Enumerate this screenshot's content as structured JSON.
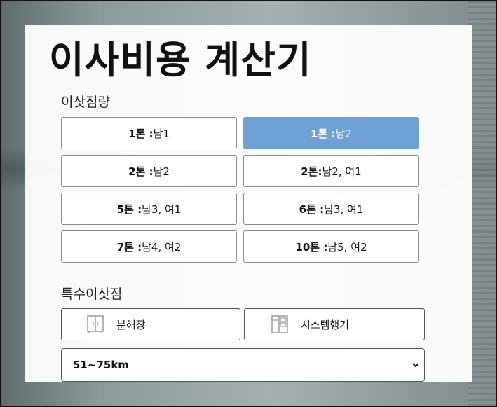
{
  "title": "이사비용 계산기",
  "volume": {
    "label": "이삿짐량",
    "options": [
      {
        "bold": "1톤 :",
        "rest": " 남1",
        "selected": false
      },
      {
        "bold": "1톤 :",
        "rest": " 남2",
        "selected": true
      },
      {
        "bold": "2톤 :",
        "rest": " 남2",
        "selected": false
      },
      {
        "bold": "2톤:",
        "rest": " 남2, 여1",
        "selected": false
      },
      {
        "bold": "5톤 :",
        "rest": " 남3, 여1",
        "selected": false
      },
      {
        "bold": "6톤 :",
        "rest": " 남3, 여1",
        "selected": false
      },
      {
        "bold": "7톤 :",
        "rest": " 남4, 여2",
        "selected": false
      },
      {
        "bold": "10톤 :",
        "rest": " 남5, 여2",
        "selected": false
      }
    ]
  },
  "special": {
    "label": "특수이삿짐",
    "items": [
      {
        "label": "분해장",
        "icon": "wardrobe-icon"
      },
      {
        "label": "시스템행거",
        "icon": "system-hanger-icon"
      }
    ]
  },
  "distance": {
    "selected": "51~75km"
  },
  "colors": {
    "accent": "#6fa0d4",
    "border": "#8a8a8a"
  }
}
